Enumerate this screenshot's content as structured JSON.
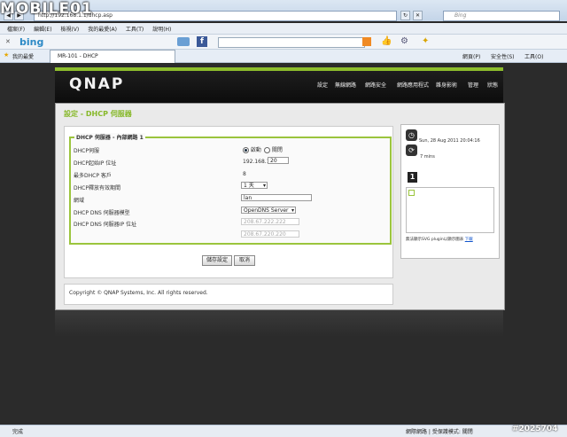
{
  "browser": {
    "address": "http://192.168.1.1/dhcp.asp",
    "bing_search_placeholder": "Bing",
    "menu": [
      "檔案(F)",
      "編輯(E)",
      "檢視(V)",
      "我的最愛(A)",
      "工具(T)",
      "說明(H)"
    ],
    "bing_logo": "bing",
    "favorites_label": "我的最愛",
    "tab_title": "MR-101 - DHCP",
    "tools": [
      "網頁(P)",
      "安全性(S)",
      "工具(O)"
    ]
  },
  "header": {
    "logo": "QNAP",
    "nav": [
      "設定",
      "無線網路",
      "網路安全",
      "網路應用程式",
      "雜身影術",
      "管理",
      "狀態"
    ]
  },
  "page": {
    "title": "設定 - DHCP 伺服器",
    "legend": "DHCP 伺服器 - 內部網路 1",
    "rows": {
      "server_label": "DHCP伺服",
      "server_on": "啟動",
      "server_off": "關閉",
      "start_ip_label": "DHCP起始IP 位址",
      "start_ip_prefix": "192.168.1.",
      "start_ip_value": "20",
      "max_clients_label": "最多DHCP 客戶",
      "max_clients_value": "8",
      "lease_label": "DHCP釋放有效期間",
      "lease_value": "1 天",
      "domain_label": "網域",
      "domain_value": "lan",
      "dns_mode_label": "DHCP DNS 伺服器模型",
      "dns_mode_value": "OpenDNS Server",
      "dns_ip_label": "DHCP DNS 伺服器IP 位址",
      "dns_ip_1": "208.67.222.222",
      "dns_ip_2": "208.67.220.220"
    },
    "save_button": "儲存設定",
    "cancel_button": "取消",
    "copyright": "Copyright © QNAP Systems, Inc. All rights reserved."
  },
  "sidebar": {
    "datetime": "Sun, 28 Aug 2011 20:04:16",
    "uptime": "7 mins",
    "badge": "1",
    "plugin_text": "無法顯示SVG plugin以顯示圖表",
    "plugin_link": "下載"
  },
  "statusbar": {
    "left": "完成",
    "right": "網際網路 | 受保護模式: 關閉"
  },
  "watermark": "#2025704",
  "site_logo": "MOBILE01"
}
